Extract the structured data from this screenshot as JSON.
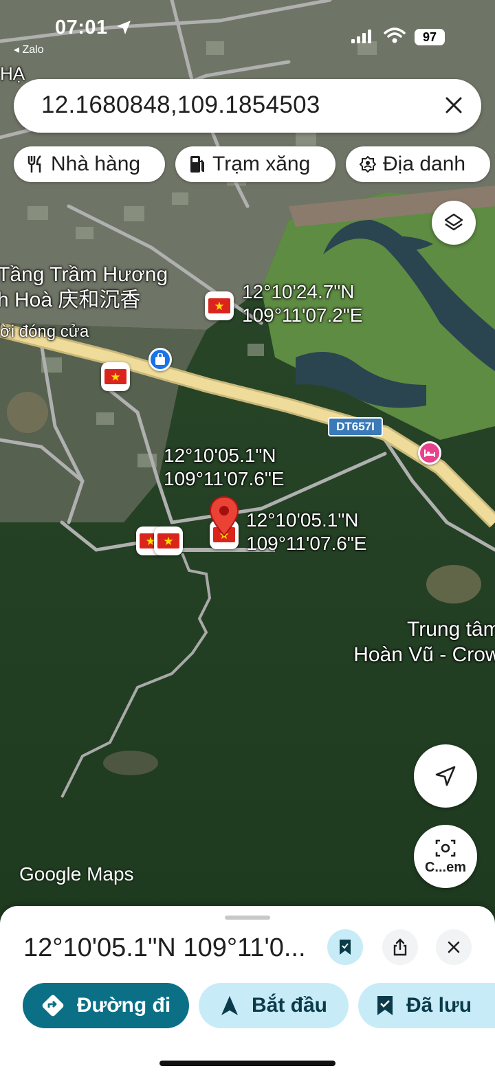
{
  "status_bar": {
    "time": "07:01",
    "back_app": "◂ Zalo",
    "battery": "97"
  },
  "search": {
    "value": "12.1680848,109.1854503"
  },
  "chips": [
    {
      "label": "Nhà hàng",
      "icon": "restaurant-icon"
    },
    {
      "label": "Trạm xăng",
      "icon": "gas-station-icon"
    },
    {
      "label": "Địa danh",
      "icon": "landmark-icon"
    }
  ],
  "map": {
    "place_labels": {
      "top_left_fragment": "HẠ",
      "poi_name_line1": "Tầng Trầm Hương",
      "poi_name_line2": "h Hoà 庆和沉香",
      "poi_status": "ời đóng cửa",
      "right_label_line1": "Trung tâm",
      "right_label_line2": "Hoàn Vũ - Crow"
    },
    "pins": [
      {
        "lat": "12°10'24.7\"N",
        "lng": "109°11'07.2\"E"
      },
      {
        "lat": "12°10'05.1\"N",
        "lng": "109°11'07.6\"E"
      },
      {
        "lat": "12°10'05.1\"N",
        "lng": "109°11'07.6\"E"
      }
    ],
    "road_label": "DT657I",
    "watermark": "Google Maps",
    "flag_glyph": "★",
    "camera_button_label": "C...em"
  },
  "sheet": {
    "title": "12°10'05.1\"N 109°11'0...",
    "actions": [
      {
        "label": "Đường đi",
        "icon": "directions-icon"
      },
      {
        "label": "Bắt đầu",
        "icon": "navigation-arrow-icon"
      },
      {
        "label": "Đã lưu",
        "icon": "bookmark-icon"
      }
    ]
  },
  "colors": {
    "accent_teal": "#0b6f86",
    "light_blue": "#c8ecf7",
    "pin_red": "#ea4335",
    "flag_red": "#da251d",
    "flag_yellow": "#ffdd00",
    "road_yellow": "#f0dc9a"
  }
}
